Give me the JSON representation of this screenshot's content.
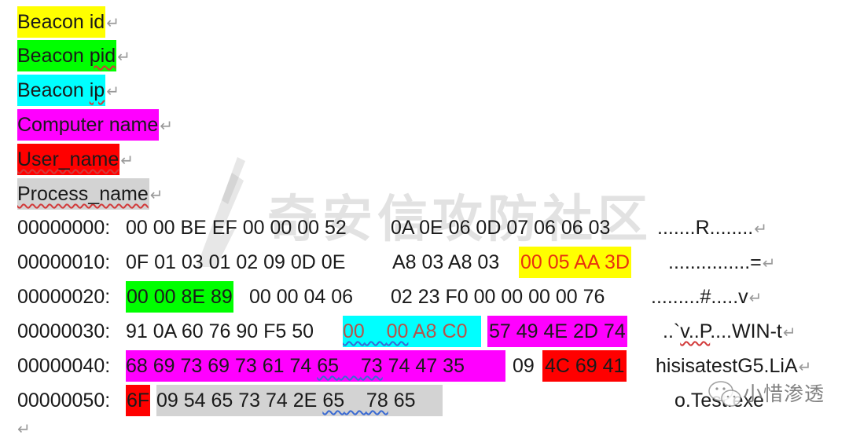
{
  "legend": [
    {
      "label": "Beacon id",
      "color": "#ffff00",
      "spell": "",
      "text_color": "#1a1a1a"
    },
    {
      "label_plain": "Beacon ",
      "label_squig": "pid",
      "color": "#00ff00",
      "text_color": "#1a1a1a"
    },
    {
      "label_plain": "Beacon ",
      "label_squig": "ip",
      "color": "#00ffff",
      "text_color": "#1a1a1a"
    },
    {
      "label": "Computer name",
      "color": "#ff00ff",
      "text_color": "#1a1a1a"
    },
    {
      "label": "User_name",
      "color": "#ff0000",
      "text_color": "#1a1a1a"
    },
    {
      "label": "Process_name",
      "color": "#d3d3d3",
      "text_color": "#1a1a1a"
    }
  ],
  "return_mark": "↵",
  "hexdump": [
    {
      "offset": "00000000:",
      "bytes_a": "00 00 BE EF 00 00 00 52",
      "bytes_b": "0A 0E 06 0D 07 06 06 03",
      "ascii": ".......R........"
    },
    {
      "offset": "00000010:",
      "bytes_a": "0F 01 03 01 02 09 0D 0E",
      "bytes_b": "A8 03 A8 03",
      "bytes_b_hl": "00 05 AA 3D",
      "ascii": "...............="
    },
    {
      "offset": "00000020:",
      "bytes_a_hl": "00 00 8E 89",
      "bytes_a": "00 00 04 06",
      "bytes_b": "02 23 F0 00 00 00 00 76",
      "ascii": ".........#.....v"
    },
    {
      "offset": "00000030:",
      "bytes_a": "91 0A 60 76 90 F5 50",
      "bytes_ip_1": "00",
      "bytes_ip_2": "00",
      "bytes_ip_3": "A8 C0",
      "bytes_b_hl": "57 49 4E 2D 74",
      "ascii_a": "..`",
      "ascii_squig": "v..P",
      "ascii_b": "....WIN-t"
    },
    {
      "offset": "00000040:",
      "bytes_hl_a": "68 69 73 69 73 61 74",
      "bytes_hl_s1": "65",
      "bytes_hl_s2": "73",
      "bytes_hl_b": "74 47 35",
      "bytes_plain": "09",
      "bytes_red": "4C 69 41",
      "ascii": "hisisatestG5.LiA"
    },
    {
      "offset": "00000050:",
      "bytes_red": "6F",
      "bytes_grey_a": "09 54 65 73 74 2E",
      "bytes_grey_s1": "65",
      "bytes_grey_s2": "78",
      "bytes_grey_b": "65",
      "ascii": "o.Test.exe"
    }
  ],
  "watermarks": {
    "center": "奇安信攻防社区",
    "corner": "小惜渗透"
  },
  "colors": {
    "beacon_id": "#ffff00",
    "beacon_pid": "#00ff00",
    "beacon_ip": "#00ffff",
    "computer_name": "#ff00ff",
    "user_name": "#ff0000",
    "process_name": "#d3d3d3",
    "highlight_text_red": "#e8310f",
    "ip_text": "#b4544a"
  }
}
